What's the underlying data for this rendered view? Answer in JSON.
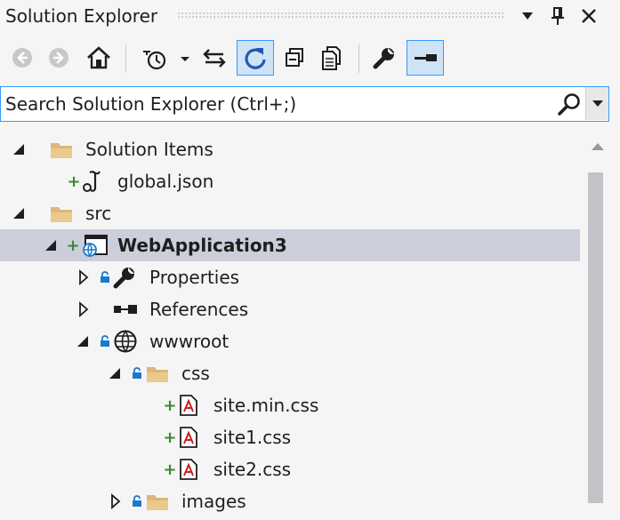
{
  "window": {
    "title": "Solution Explorer",
    "dropdown_icon": "dropdown-arrow-icon",
    "pin_icon": "pin-icon",
    "close_icon": "close-icon"
  },
  "toolbar": {
    "buttons": [
      {
        "icon": "back-icon",
        "enabled": false
      },
      {
        "icon": "forward-icon",
        "enabled": false
      },
      {
        "icon": "home-icon",
        "enabled": true
      },
      {
        "icon": "pending-changes-filter-icon",
        "enabled": true
      },
      {
        "icon": "sync-with-active-document-icon",
        "enabled": true
      },
      {
        "icon": "refresh-icon",
        "enabled": true,
        "active": true
      },
      {
        "icon": "collapse-all-icon",
        "enabled": true
      },
      {
        "icon": "show-all-files-icon",
        "enabled": true
      },
      {
        "icon": "properties-wrench-icon",
        "enabled": true
      },
      {
        "icon": "preview-selected-items-icon",
        "enabled": true,
        "active": true
      }
    ]
  },
  "search": {
    "placeholder": "Search Solution Explorer (Ctrl+;)"
  },
  "tree": {
    "items": [
      {
        "label": "Solution Items",
        "expanded": true,
        "icon": "folder-icon"
      },
      {
        "label": "global.json",
        "icon": "json-file-icon",
        "added": true
      },
      {
        "label": "src",
        "expanded": true,
        "icon": "folder-icon"
      },
      {
        "label": "WebApplication3",
        "expanded": true,
        "icon": "web-project-icon",
        "added": true,
        "selected": true,
        "bold": true
      },
      {
        "label": "Properties",
        "expanded": false,
        "icon": "wrench-icon",
        "locked": true
      },
      {
        "label": "References",
        "expanded": false,
        "icon": "references-icon"
      },
      {
        "label": "wwwroot",
        "expanded": true,
        "icon": "globe-icon",
        "locked": true
      },
      {
        "label": "css",
        "expanded": true,
        "icon": "folder-icon",
        "locked": true
      },
      {
        "label": "site.min.css",
        "icon": "css-file-icon",
        "added": true
      },
      {
        "label": "site1.css",
        "icon": "css-file-icon",
        "added": true
      },
      {
        "label": "site2.css",
        "icon": "css-file-icon",
        "added": true
      },
      {
        "label": "images",
        "expanded": false,
        "icon": "folder-icon",
        "locked": true
      }
    ]
  },
  "colors": {
    "accent": "#3399ff",
    "selection": "#cccedb",
    "background": "#f5f5f5",
    "added_marker": "#388a34",
    "lock_marker": "#1c79d0",
    "folder": "#dcb67a"
  }
}
